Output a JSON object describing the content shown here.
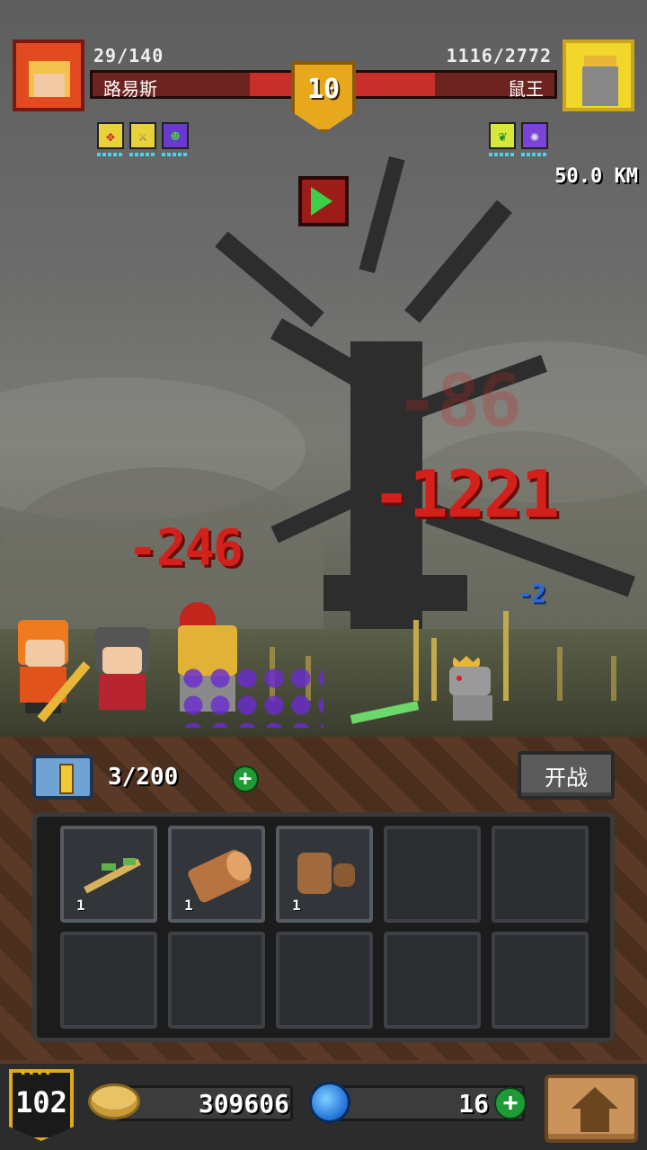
{
  "hero": {
    "hp_text": "29/140",
    "name": "路易斯",
    "hp_fraction": 0.21
  },
  "boss": {
    "hp_text": "1116/2772",
    "name": "鼠王",
    "hp_fraction": 0.4
  },
  "stage_level": "10",
  "distance": "50.0 KM",
  "hero_buffs": [
    "target-buff-icon",
    "sword-buff-icon",
    "poison-buff-icon"
  ],
  "boss_buffs": [
    "nature-buff-icon",
    "claw-buff-icon"
  ],
  "damage_numbers": {
    "hero_damage": "-246",
    "boss_damage": "-1221",
    "small_damage": "-2",
    "faded_damage": "-86"
  },
  "inventory": {
    "count": "3/200",
    "fight_label": "开战",
    "slots": [
      {
        "item": "branch-icon",
        "qty": "1"
      },
      {
        "item": "wood-log-icon",
        "qty": "1"
      },
      {
        "item": "leather-icon",
        "qty": "1"
      },
      {
        "item": "",
        "qty": ""
      },
      {
        "item": "",
        "qty": ""
      },
      {
        "item": "",
        "qty": ""
      },
      {
        "item": "",
        "qty": ""
      },
      {
        "item": "",
        "qty": ""
      },
      {
        "item": "",
        "qty": ""
      },
      {
        "item": "",
        "qty": ""
      }
    ]
  },
  "bottom": {
    "player_level": "102",
    "gold": "309606",
    "gems": "16"
  },
  "colors": {
    "hp_red": "#c62f2a",
    "gold_badge": "#e8a81e",
    "plus_green": "#1f9a36"
  }
}
